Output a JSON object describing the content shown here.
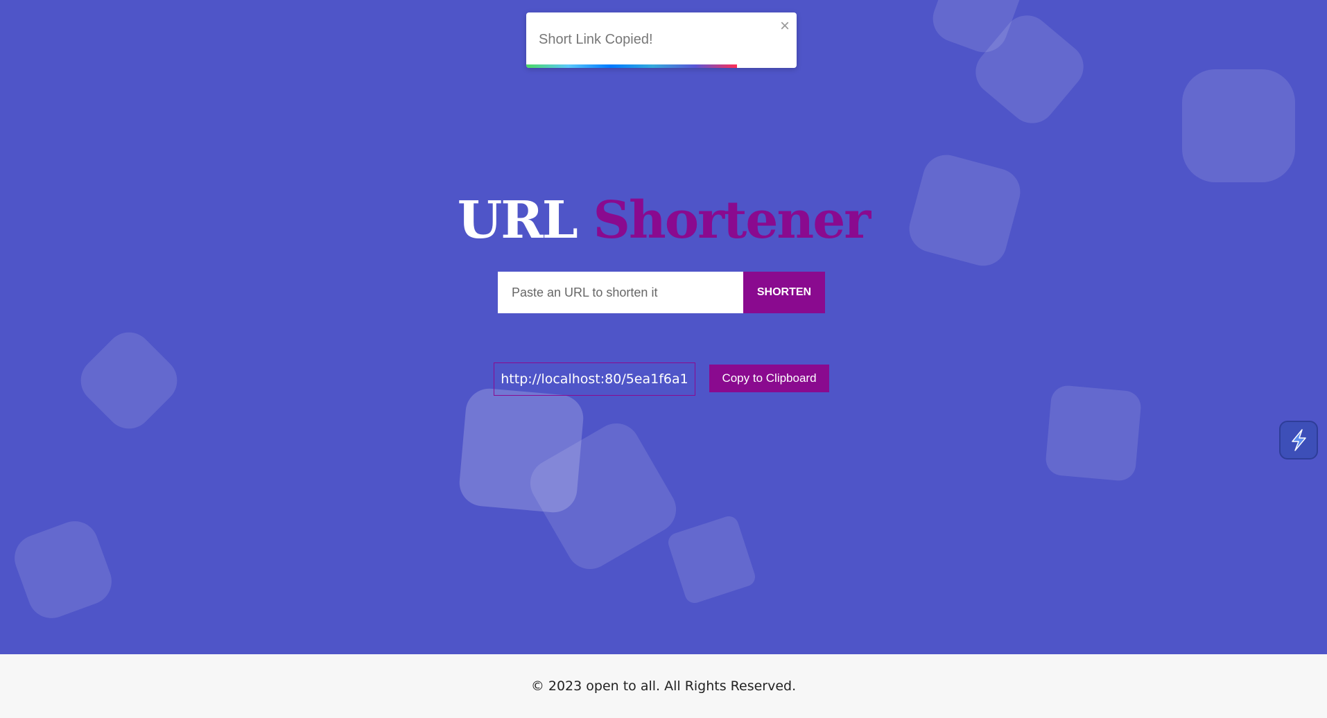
{
  "toast": {
    "message": "Short Link Copied!",
    "close_symbol": "×",
    "close_icon": "close-icon",
    "progress_fraction": 0.78
  },
  "header": {
    "title_part1": "URL",
    "title_part2": "Shortener"
  },
  "form": {
    "placeholder": "Paste an URL to shorten it",
    "value": "",
    "shorten_label": "SHORTEN"
  },
  "result": {
    "short_url": "http://localhost:80/5ea1f6a1",
    "copy_label": "Copy to Clipboard"
  },
  "widget": {
    "icon": "lightning-icon"
  },
  "footer": {
    "text": "© 2023 open to all. All Rights Reserved."
  },
  "colors": {
    "background": "#4f55c8",
    "accent": "#8a0a8f",
    "footer_bg": "#f7f7f7"
  }
}
